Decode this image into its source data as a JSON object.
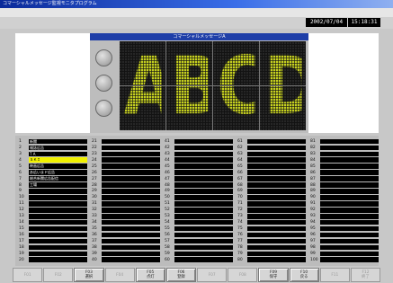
{
  "window": {
    "title": "コマーシャルメッセージ監視モニタプログラム"
  },
  "header": {
    "date": "2002/07/04",
    "time": "15:18:31"
  },
  "message": {
    "title": "コマーシャルメッセージA",
    "display_text": [
      "A",
      "B",
      "C",
      "D"
    ],
    "led_color": "#c6d020",
    "lamp_count": 3
  },
  "list": {
    "columns": [
      {
        "start": 1,
        "items": [
          "新聞",
          "雑誌広告",
          "T A",
          "ＳＫＩ",
          "映画広告",
          "あ広いまド広告",
          "総合新聞広告配信",
          "工場"
        ],
        "highlight_index": 3
      },
      {
        "start": 21,
        "items": []
      },
      {
        "start": 41,
        "items": []
      },
      {
        "start": 61,
        "items": []
      },
      {
        "start": 81,
        "items": []
      }
    ],
    "rows_per_column": 20,
    "highlight_color": "#f2f200"
  },
  "buttons": [
    {
      "line1": "F01",
      "line2": "",
      "enabled": false
    },
    {
      "line1": "F02",
      "line2": "",
      "enabled": false
    },
    {
      "line1": "F03",
      "line2": "選択",
      "enabled": true
    },
    {
      "line1": "F04",
      "line2": "",
      "enabled": false
    },
    {
      "line1": "F05",
      "line2": "点灯",
      "enabled": true
    },
    {
      "line1": "F06",
      "line2": "登録",
      "enabled": true
    },
    {
      "line1": "F07",
      "line2": "",
      "enabled": false
    },
    {
      "line1": "F08",
      "line2": "",
      "enabled": false
    },
    {
      "line1": "F09",
      "line2": "保守",
      "enabled": true
    },
    {
      "line1": "F10",
      "line2": "戻る",
      "enabled": true
    },
    {
      "line1": "F11",
      "line2": "",
      "enabled": false
    },
    {
      "line1": "F12",
      "line2": "終了",
      "enabled": false
    }
  ]
}
